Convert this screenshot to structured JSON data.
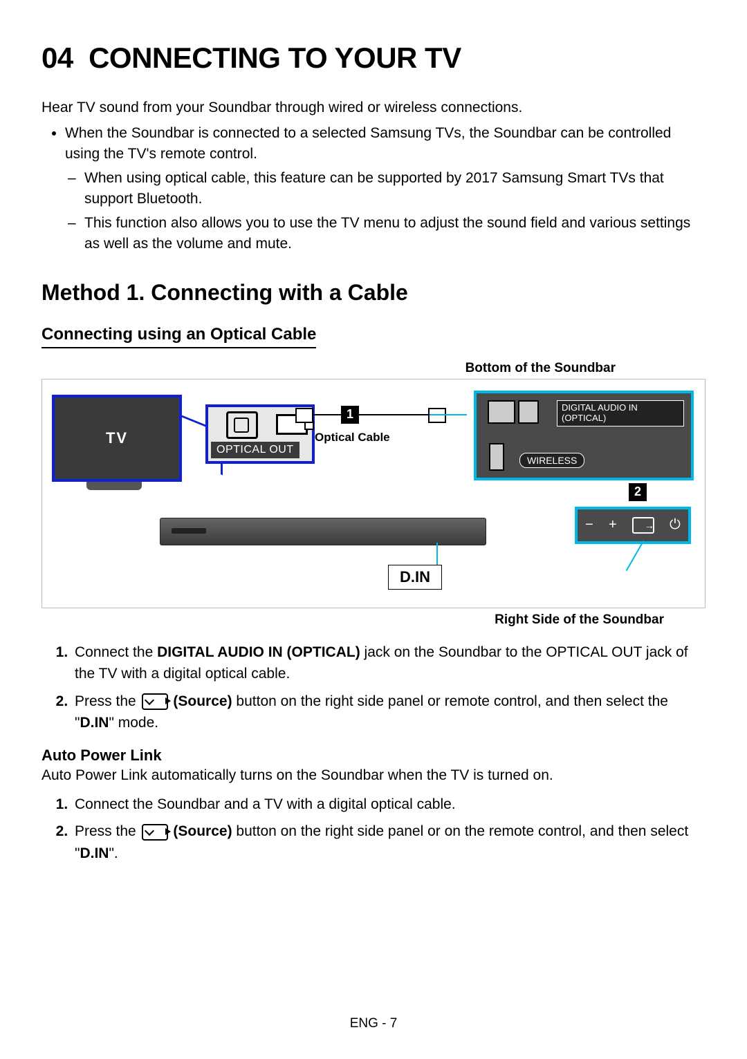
{
  "section_number": "04",
  "title": "CONNECTING TO YOUR TV",
  "intro": "Hear TV sound from your Soundbar through wired or wireless connections.",
  "bullet1": "When the Soundbar is connected to a selected Samsung TVs, the Soundbar can be controlled using the TV's remote control.",
  "dash1": "When using optical cable, this feature can be supported by 2017 Samsung Smart TVs that support Bluetooth.",
  "dash2": "This function also allows you to use the TV menu to adjust the sound field and various settings as well as the volume and mute.",
  "method_heading": "Method 1. Connecting with a Cable",
  "sub_heading": "Connecting using an Optical Cable",
  "diagram": {
    "top_caption": "Bottom of the Soundbar",
    "bottom_caption": "Right Side of the Soundbar",
    "tv_label": "TV",
    "optical_out": "OPTICAL OUT",
    "cable_label": "Optical Cable",
    "digital_audio_in": "DIGITAL AUDIO IN (OPTICAL)",
    "wireless": "WIRELESS",
    "callout1": "1",
    "callout2": "2",
    "din": "D.IN",
    "minus": "−",
    "plus": "+"
  },
  "step1_a": "Connect the ",
  "step1_b": "DIGITAL AUDIO IN (OPTICAL)",
  "step1_c": " jack on the Soundbar to the OPTICAL OUT jack of the TV with a digital optical cable.",
  "step2_a": "Press the ",
  "step2_b": "(Source)",
  "step2_c": " button on the right side panel or remote control, and then select the \"",
  "step2_d": "D.IN",
  "step2_e": "\" mode.",
  "apl_heading": "Auto Power Link",
  "apl_intro": "Auto Power Link automatically turns on the Soundbar when the TV is turned on.",
  "apl_step1": "Connect the Soundbar and a TV with a digital optical cable.",
  "apl_step2_a": "Press the ",
  "apl_step2_b": "(Source)",
  "apl_step2_c": " button on the right side panel or on the remote control, and then select \"",
  "apl_step2_d": "D.IN",
  "apl_step2_e": "\".",
  "footer": "ENG - 7"
}
